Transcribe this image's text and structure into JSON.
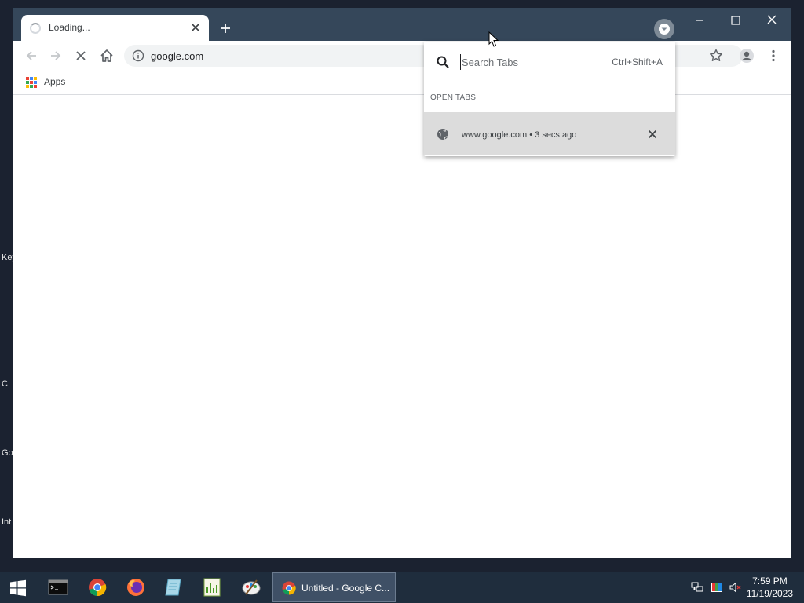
{
  "desktop": {
    "edge_labels": [
      "Key",
      "C",
      "Go",
      "Int"
    ]
  },
  "browser": {
    "tab": {
      "title": "Loading..."
    },
    "toolbar": {
      "url": "google.com"
    },
    "bookmarks": {
      "apps_label": "Apps"
    }
  },
  "tab_search": {
    "placeholder": "Search Tabs",
    "shortcut": "Ctrl+Shift+A",
    "section_label": "OPEN TABS",
    "results": [
      {
        "title": "www.google.com",
        "meta": "3 secs ago"
      }
    ]
  },
  "taskbar": {
    "active_window": "Untitled - Google C...",
    "time": "7:59 PM",
    "date": "11/19/2023"
  },
  "colors": {
    "titlebar": "#35475a",
    "taskbar": "#1f2d3d",
    "desktop": "#1b2230"
  }
}
